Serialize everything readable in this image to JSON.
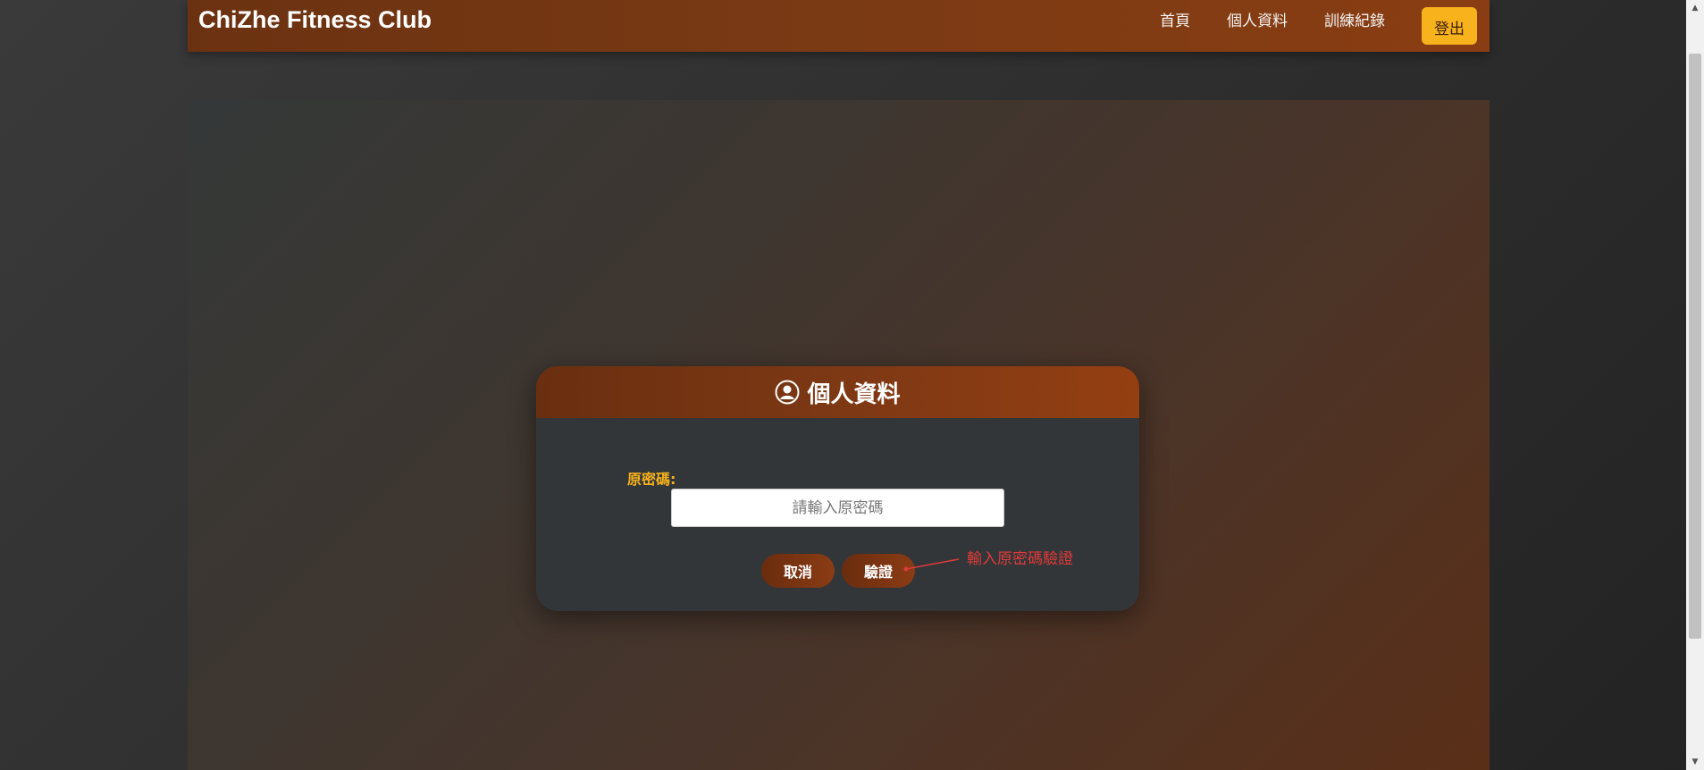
{
  "navbar": {
    "brand": "ChiZhe Fitness Club",
    "links": [
      {
        "label": "首頁"
      },
      {
        "label": "個人資料"
      },
      {
        "label": "訓練紀錄"
      }
    ],
    "logout_label": "登出"
  },
  "card": {
    "title": "個人資料",
    "field_label": "原密碼:",
    "input_placeholder": "請輸入原密碼",
    "input_value": "",
    "cancel_label": "取消",
    "verify_label": "驗證"
  },
  "annotation": {
    "text": "輸入原密碼驗證"
  },
  "colors": {
    "accent": "#f8b21c",
    "brand_brown": "#7a3a14",
    "annotation_red": "#e03a3a"
  },
  "icons": {
    "card_header": "user-circle-icon"
  }
}
